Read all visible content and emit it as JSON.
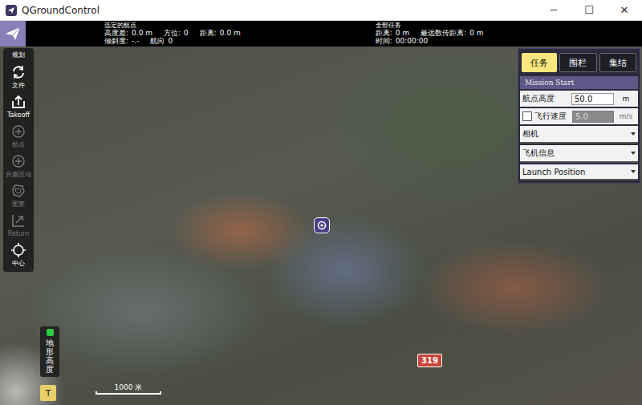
{
  "window": {
    "title": "QGroundControl",
    "controls": [
      "─",
      "☐",
      "✕"
    ]
  },
  "toolbar": {
    "selected_waypoint": {
      "heading": "选定的航点",
      "rows": [
        [
          {
            "label": "高度差:",
            "value": "0.0 m"
          },
          {
            "label": "方位:",
            "value": "0"
          },
          {
            "label": "距离:",
            "value": "0.0 m"
          }
        ],
        [
          {
            "label": "倾斜度:",
            "value": "-.-"
          },
          {
            "label": "航向",
            "value": "0"
          }
        ]
      ]
    },
    "mission": {
      "heading": "全部任务",
      "rows": [
        [
          {
            "label": "距离:",
            "value": "0 m"
          },
          {
            "label": "最远数传距离:",
            "value": "0 m"
          }
        ],
        [
          {
            "label": "时间:",
            "value": "00:00:00"
          }
        ]
      ]
    }
  },
  "sidebar": {
    "title": "规划",
    "items": [
      {
        "label": "文件",
        "disabled": false
      },
      {
        "label": "Takeoff",
        "disabled": false
      },
      {
        "label": "航点",
        "disabled": true
      },
      {
        "label": "兴趣区域",
        "disabled": true
      },
      {
        "label": "图案",
        "disabled": true
      },
      {
        "label": "Return",
        "disabled": true
      },
      {
        "label": "中心",
        "disabled": false
      }
    ]
  },
  "plan_panel": {
    "tabs": [
      {
        "label": "任务",
        "selected": true
      },
      {
        "label": "围栏",
        "selected": false
      },
      {
        "label": "集结",
        "selected": false
      }
    ],
    "header": "Mission Start",
    "altitude": {
      "label": "航点高度",
      "value": "50.0",
      "unit": "m"
    },
    "speed": {
      "label": "飞行速度",
      "checked": false,
      "disabled": true,
      "value": "5.0",
      "unit": "m/s"
    },
    "sections": [
      {
        "label": "相机",
        "expanded": false
      },
      {
        "label": "飞机信息",
        "expanded": false
      },
      {
        "label": "Launch Position",
        "expanded": false
      }
    ]
  },
  "map": {
    "road_label": "319",
    "terrain_label": "地形高度",
    "terrain_button": "T",
    "scale": "1000 米"
  }
}
